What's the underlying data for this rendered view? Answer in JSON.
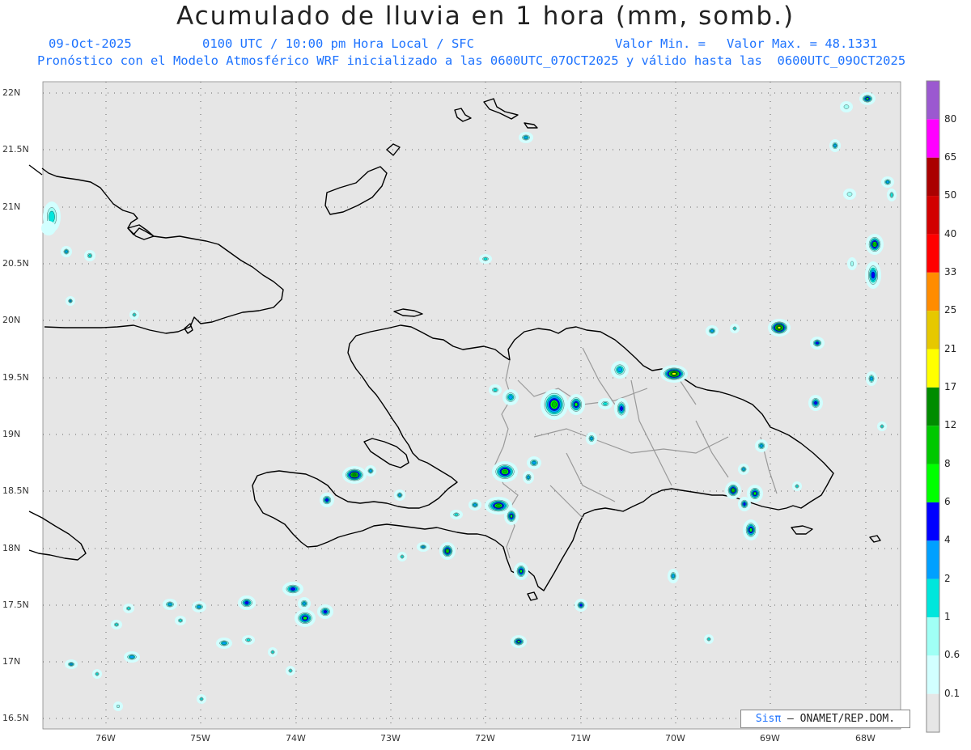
{
  "header": {
    "title": "Acumulado de lluvia en 1 hora (mm, somb.)",
    "date": "09-Oct-2025",
    "time": "0100 UTC / 10:00 pm Hora Local / SFC",
    "valor_min": "Valor Min. =",
    "valor_max": "Valor Max. = 48.1331",
    "model_line": "Pronóstico con el Modelo Atmosférico WRF inicializado a las 0600UTC_07OCT2025 y válido hasta las  0600UTC_09OCT2025"
  },
  "map": {
    "background_color": "#e6e6e6",
    "lat_labels": [
      "22N",
      "21.5N",
      "21N",
      "20.5N",
      "20N",
      "19.5N",
      "19N",
      "18.5N",
      "18N",
      "17.5N",
      "17N",
      "16.5N"
    ],
    "lon_labels": [
      "76W",
      "75W",
      "74W",
      "73W",
      "72W",
      "71W",
      "70W",
      "69W",
      "68W"
    ]
  },
  "colorbar": {
    "levels": [
      "0.1",
      "0.6",
      "1",
      "2",
      "4",
      "6",
      "8",
      "12",
      "17",
      "21",
      "25",
      "33",
      "40",
      "50",
      "65",
      "80"
    ],
    "colors": [
      "#e6e6e6",
      "#d2ffff",
      "#a0fff5",
      "#00e6dc",
      "#00a0ff",
      "#0000ff",
      "#00ff00",
      "#00c800",
      "#008c00",
      "#ffff00",
      "#e6c800",
      "#ff8c00",
      "#ff0000",
      "#d20000",
      "#aa0000",
      "#ff00ff",
      "#9b59d0"
    ]
  },
  "credit": {
    "sis": "Sisπ",
    "org": "– ONAMET/REP.DOM."
  },
  "rain_cells": [
    {
      "region": "caribbean",
      "count": 60
    }
  ]
}
